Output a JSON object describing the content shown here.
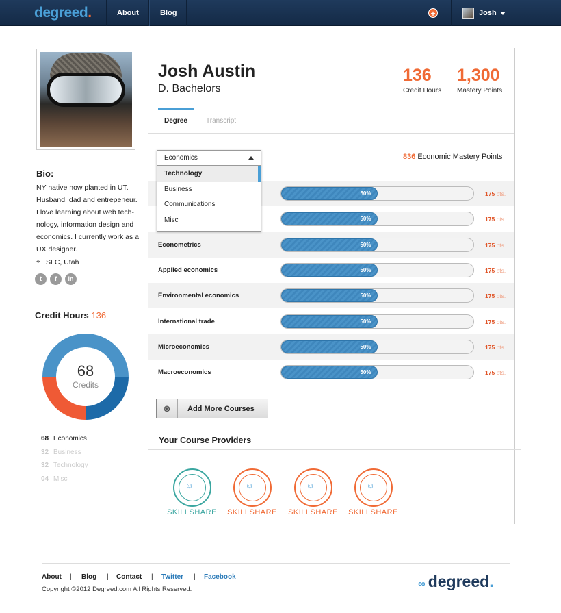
{
  "nav": {
    "logo": "degreed",
    "logo_dot": ".",
    "links": [
      "About",
      "Blog"
    ],
    "plus": "+",
    "user": "Josh"
  },
  "profile": {
    "bio_title": "Bio:",
    "bio": "NY native now planted in UT. Husband, dad and entrepeneur. I love learning about web tech-nology, information design and economics. I currently work as a UX designer.",
    "location": "SLC, Utah",
    "social": [
      "t",
      "f",
      "in"
    ]
  },
  "credit_hours": {
    "title": "Credit Hours",
    "value": "136",
    "center_num": "68",
    "center_label": "Credits",
    "legend": [
      {
        "n": "68",
        "label": "Economics",
        "color": "#222222"
      },
      {
        "n": "32",
        "label": "Business",
        "color": "#cccccc"
      },
      {
        "n": "32",
        "label": "Technology",
        "color": "#cccccc"
      },
      {
        "n": "04",
        "label": "Misc",
        "color": "#cccccc"
      }
    ],
    "segments": [
      {
        "value": 50,
        "color": "#4a93c8"
      },
      {
        "value": 25,
        "color": "#1d6aa8"
      },
      {
        "value": 25,
        "color": "#ef5a35"
      }
    ]
  },
  "header": {
    "name": "Josh Austin",
    "degree": "D. Bachelors",
    "stat1_num": "136",
    "stat1_lbl": "Credit Hours",
    "stat2_num": "1,300",
    "stat2_lbl": "Mastery Points"
  },
  "tabs": {
    "active": "Degree",
    "inactive": "Transcript"
  },
  "mastery": {
    "num": "836",
    "label": "Economic Mastery Points"
  },
  "dropdown": {
    "selected": "Economics",
    "options": [
      "Technology",
      "Business",
      "Communications",
      "Misc"
    ]
  },
  "courses": [
    {
      "label": "",
      "percent": 50,
      "percent_label": "50%",
      "pts": "175",
      "unit": "pts."
    },
    {
      "label": "",
      "percent": 50,
      "percent_label": "50%",
      "pts": "175",
      "unit": "pts."
    },
    {
      "label": "Econometrics",
      "percent": 50,
      "percent_label": "50%",
      "pts": "175",
      "unit": "pts."
    },
    {
      "label": "Applied economics",
      "percent": 50,
      "percent_label": "50%",
      "pts": "175",
      "unit": "pts."
    },
    {
      "label": "Environmental economics",
      "percent": 50,
      "percent_label": "50%",
      "pts": "175",
      "unit": "pts."
    },
    {
      "label": "International trade",
      "percent": 50,
      "percent_label": "50%",
      "pts": "175",
      "unit": "pts."
    },
    {
      "label": "Microeconomics",
      "percent": 50,
      "percent_label": "50%",
      "pts": "175",
      "unit": "pts."
    },
    {
      "label": "Macroeconomics",
      "percent": 50,
      "percent_label": "50%",
      "pts": "175",
      "unit": "pts."
    }
  ],
  "add_button": {
    "icon": "⊕",
    "label": "Add More Courses"
  },
  "providers": {
    "title": "Your Course Providers",
    "items": [
      {
        "name": "SKILLSHARE",
        "color": "#3aa6a0"
      },
      {
        "name": "SKILLSHARE",
        "color": "#f06a35"
      },
      {
        "name": "SKILLSHARE",
        "color": "#f06a35"
      },
      {
        "name": "SKILLSHARE",
        "color": "#f06a35"
      }
    ]
  },
  "footer": {
    "links": [
      {
        "label": "About",
        "color": "#222222"
      },
      {
        "label": "Blog",
        "color": "#222222"
      },
      {
        "label": "Contact",
        "color": "#222222"
      },
      {
        "label": "Twitter",
        "color": "#2a7ab8"
      },
      {
        "label": "Facebook",
        "color": "#2a7ab8"
      }
    ],
    "sep": "|",
    "copyright": "Copyright ©2012 Degreed.com All Rights Reserved.",
    "logo": "degreed",
    "logo_dot": "."
  }
}
